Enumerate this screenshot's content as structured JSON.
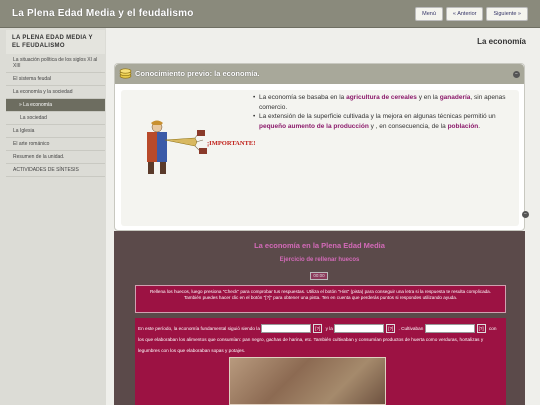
{
  "header": {
    "site_title": "La Plena Edad Media y el feudalismo",
    "nav": [
      "Menú",
      "« Anterior",
      "Siguiente »"
    ]
  },
  "sidebar": {
    "heading": "LA PLENA EDAD MEDIA Y EL FEUDALISMO",
    "items": [
      {
        "label": "La situación política de los siglos XI al XIII",
        "level": 0,
        "active": false
      },
      {
        "label": "El sistema feudal",
        "level": 0,
        "active": false
      },
      {
        "label": "La economía y la sociedad",
        "level": 0,
        "active": false
      },
      {
        "label": "» La economía",
        "level": 1,
        "active": true
      },
      {
        "label": "La sociedad",
        "level": 2,
        "active": false
      },
      {
        "label": "La Iglesia",
        "level": 0,
        "active": false
      },
      {
        "label": "El arte románico",
        "level": 0,
        "active": false
      },
      {
        "label": "Resumen de la unidad.",
        "level": 0,
        "active": false
      },
      {
        "label": "ACTIVIDADES DE SÍNTESIS",
        "level": 0,
        "active": false
      }
    ]
  },
  "main": {
    "page_heading": "La economía",
    "panel": {
      "title": "Conocimiento previo: la economía.",
      "important_label": "¡IMPORTANTE!",
      "bullets": [
        [
          {
            "t": "La economía se basaba en la ",
            "hl": false
          },
          {
            "t": "agricultura de cereales",
            "hl": true
          },
          {
            "t": " y en la ",
            "hl": false
          },
          {
            "t": "ganadería",
            "hl": true
          },
          {
            "t": ", sin apenas comercio.",
            "hl": false
          }
        ],
        [
          {
            "t": "La extensión de la superficie cultivada y la mejora en algunas técnicas permitió un ",
            "hl": false
          },
          {
            "t": "pequeño aumento de la producción",
            "hl": true
          },
          {
            "t": " y , en consecuencia, de la ",
            "hl": false
          },
          {
            "t": "población",
            "hl": true
          },
          {
            "t": ".",
            "hl": false
          }
        ]
      ]
    },
    "exercise": {
      "title": "La economía en la Plena Edad Media",
      "subtitle": "Ejercicio de rellenar huecos",
      "timer": "00:00",
      "instructions": "Rellena los huecos, luego presiona \"Check\" para comprobar tus respuestas. Utiliza el botón \"Hint\" (pista) para conseguir una letra si la respuesta te resulta complicada. También puedes hacer clic en el botón \"[?]\" para obtener una pista. Ten en cuenta que perderás puntos si respondes utilizando ayuda.",
      "text_1": "En este período, la economía fundamental siguió siendo la",
      "text_2": "y la",
      "text_3": ". Cultivaban",
      "text_4": "con los que elaboraban los alimentos que consumían: pan negro, gachas de harina, etc. También cultivaban y consumían productos de huerta como verduras, hortalizas y legumbres con los que elaboraban sopas y potajes.",
      "hint_label": "[?]"
    }
  }
}
